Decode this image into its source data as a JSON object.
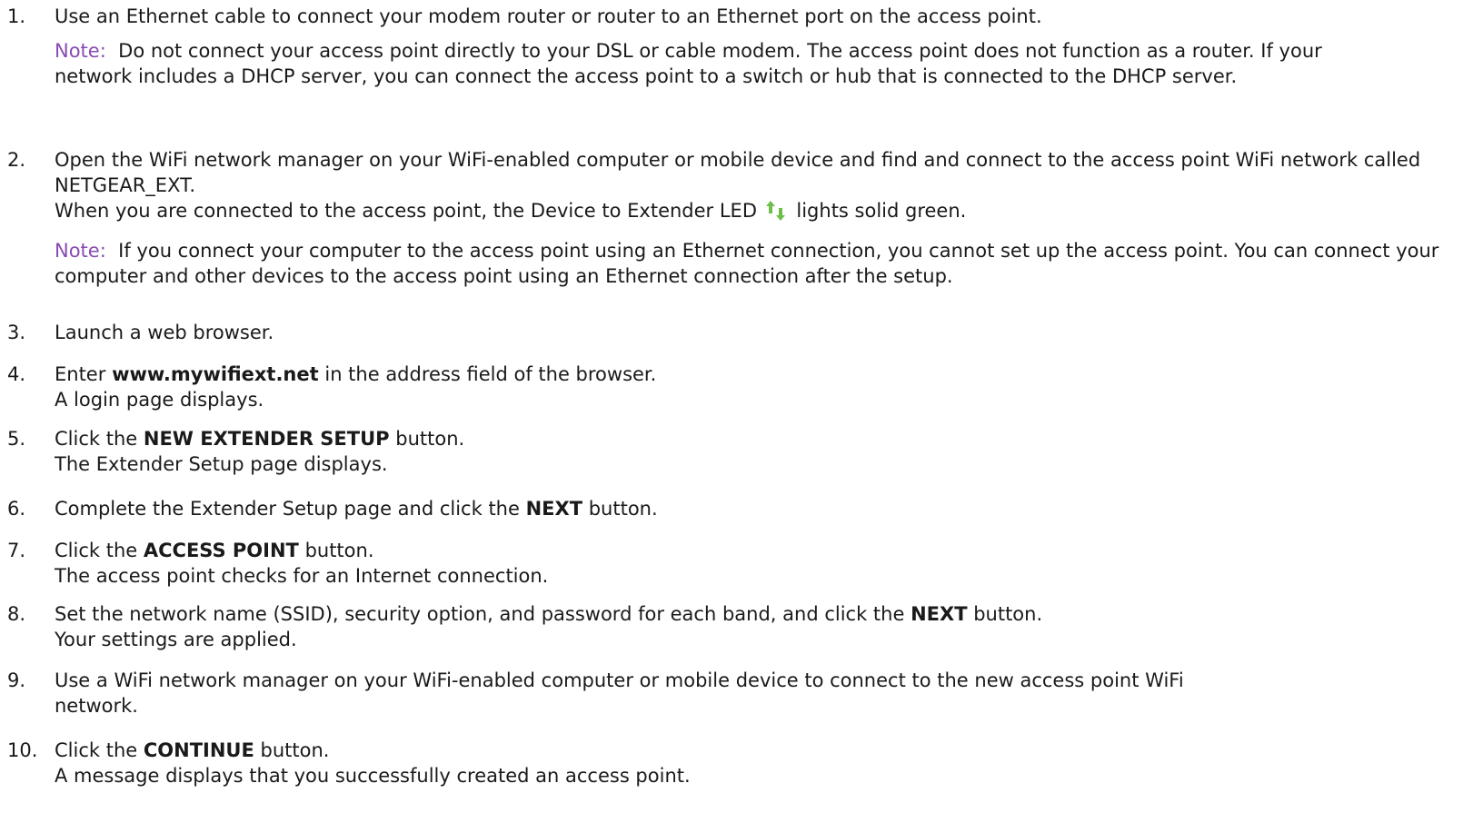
{
  "steps": [
    {
      "num": "1.",
      "pre": "Use an Ethernet cable to connect your modem router or router to an Ethernet port on the access point.",
      "note_label": "Note:",
      "note_text": "Do not connect your access point directly to your DSL or cable modem. The access point does not function as a router. If your network includes a DHCP server, you can connect the access point to a switch or hub that is connected to the DHCP server."
    },
    {
      "num": "2.",
      "line1": "Open the WiFi network manager on your WiFi-enabled computer or mobile device and find and connect to the access point WiFi network called NETGEAR_EXT.",
      "line2_pre": "When you are connected to the access point, the Device to Extender LED",
      "line2_post": "lights solid green.",
      "led_icon": "up-down-arrows-icon",
      "note_label": "Note:",
      "note_text": "If you connect your computer to the access point using an Ethernet connection, you cannot set up the access point. You can connect your computer and other devices to the access point using an Ethernet connection after the setup."
    },
    {
      "num": "3.",
      "text": "Launch a web browser."
    },
    {
      "num": "4.",
      "pre": "Enter",
      "bold": "www.mywifiext.net",
      "post": "in the address field of the browser.",
      "result": "A login page displays."
    },
    {
      "num": "5.",
      "pre": "Click the",
      "bold": "NEW EXTENDER SETUP",
      "post": "button.",
      "result": "The Extender Setup page displays."
    },
    {
      "num": "6.",
      "pre": "Complete the Extender Setup page and click the",
      "bold": "NEXT",
      "post": "button."
    },
    {
      "num": "7.",
      "pre": "Click the",
      "bold": "ACCESS POINT",
      "post": "button.",
      "result": "The access point checks for an Internet connection."
    },
    {
      "num": "8.",
      "pre": "Set the network name (SSID), security option, and password for each band, and click the",
      "bold": "NEXT",
      "post": "button.",
      "result": "Your settings are applied."
    },
    {
      "num": "9.",
      "line1": "Use a WiFi network manager on your WiFi-enabled computer or mobile device to connect to the new access point WiFi",
      "line2": "network."
    },
    {
      "num": "10.",
      "pre": "Click the",
      "bold": "CONTINUE",
      "post": "button.",
      "result": "A message displays that you successfully created an access point."
    }
  ],
  "colors": {
    "note_label": "#8a4bb3",
    "led_up": "#6cc04a",
    "led_down": "#6cc04a",
    "text": "#1a1a1a"
  }
}
